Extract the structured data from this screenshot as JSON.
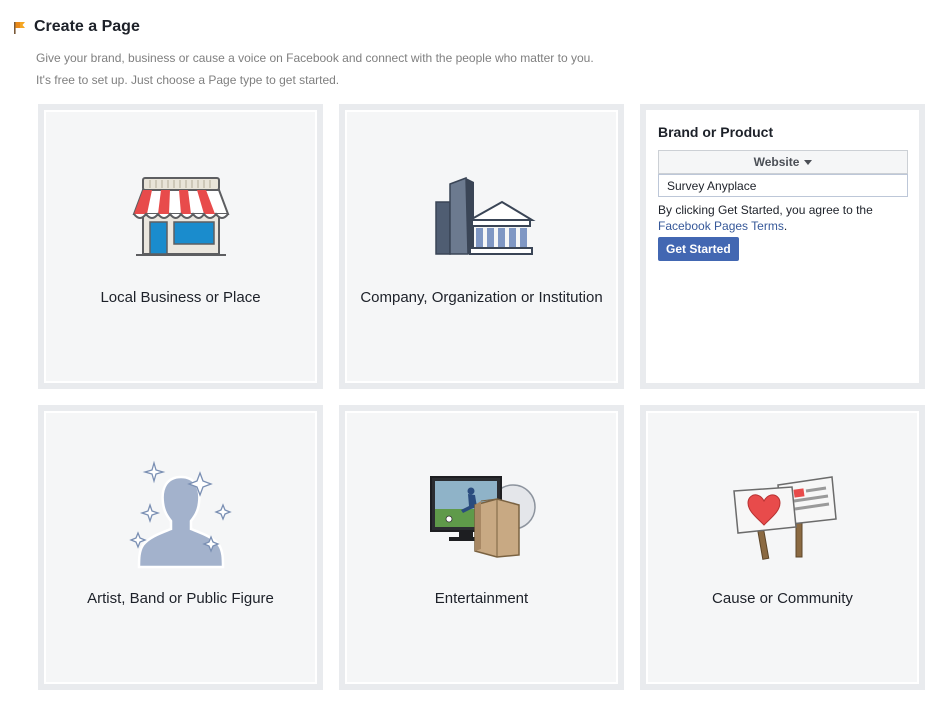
{
  "header": {
    "title": "Create a Page",
    "description_line1": "Give your brand, business or cause a voice on Facebook and connect with the people who matter to you.",
    "description_line2": "It's free to set up. Just choose a Page type to get started."
  },
  "tiles": [
    {
      "label": "Local Business or Place",
      "icon": "storefront-icon"
    },
    {
      "label": "Company, Organization or Institution",
      "icon": "buildings-icon"
    },
    {
      "label": "Brand or Product",
      "icon": "none"
    },
    {
      "label": "Artist, Band or Public Figure",
      "icon": "person-silhouette-icon"
    },
    {
      "label": "Entertainment",
      "icon": "tv-book-disc-icon"
    },
    {
      "label": "Cause or Community",
      "icon": "protest-signs-icon"
    }
  ],
  "brand_form": {
    "title": "Brand or Product",
    "category_selected": "Website",
    "name_value": "Survey Anyplace",
    "terms_text": "By clicking Get Started, you agree to the",
    "terms_link": "Facebook Pages Terms",
    "terms_end": ".",
    "button_label": "Get Started"
  },
  "colors": {
    "accent": "#4267b2",
    "link": "#365899",
    "tile_bg": "#f5f6f7",
    "tile_border": "#e9ebee"
  }
}
